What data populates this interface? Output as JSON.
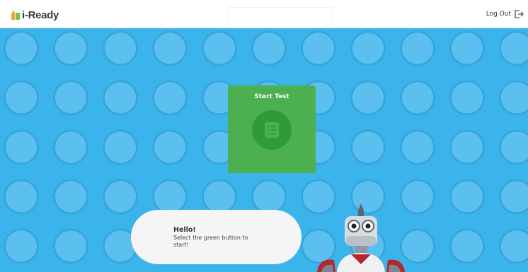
{
  "header": {
    "logo_text": "i-Ready",
    "logout_label": "Log Out"
  },
  "main": {
    "start_button": {
      "title": "Start Test",
      "icon": "document-list-icon",
      "color": "#4caf50"
    }
  },
  "assistant": {
    "greeting": "Hello!",
    "message": "Select the green button to start!"
  },
  "colors": {
    "background": "#3bb4ec",
    "header": "#ffffff",
    "start_card": "#4caf50",
    "start_icon_bg": "#2e9b3b",
    "bubble": "#f5f5f5"
  }
}
